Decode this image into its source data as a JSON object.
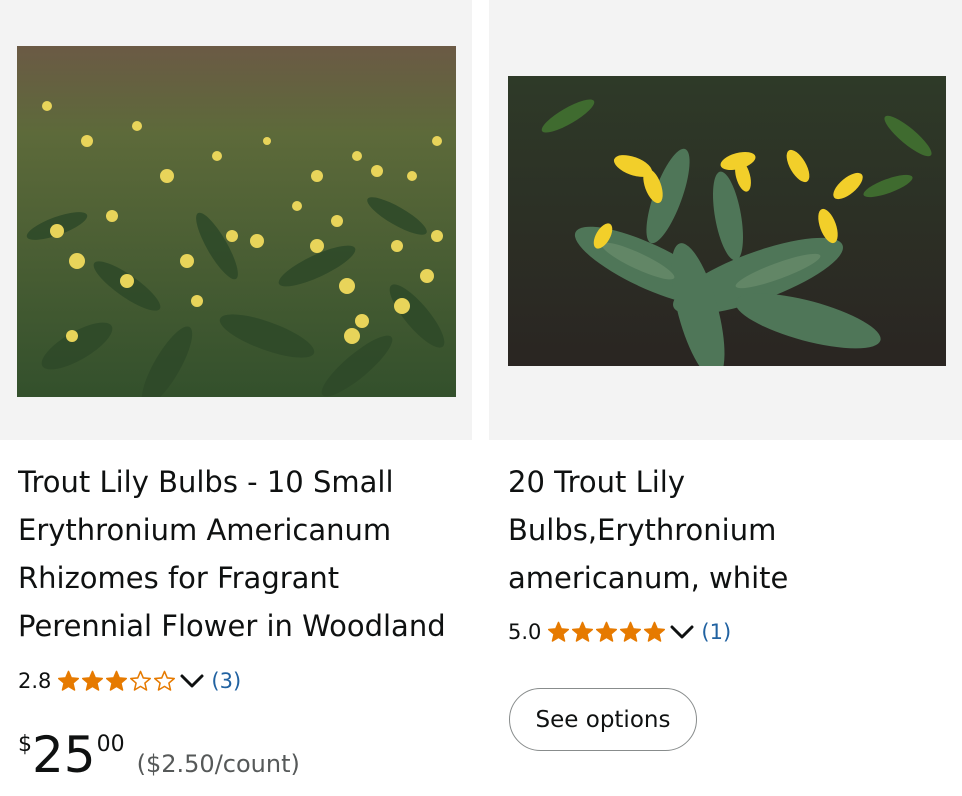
{
  "colors": {
    "star": "#e67a00",
    "link": "#2162a1",
    "image_well": "#f3f3f3"
  },
  "products": [
    {
      "title": "Trout Lily Bulbs - 10 Small Erythronium Americanum Rhizomes for Fragrant Perennial Flower in Woodland",
      "rating": "2.8",
      "stars": [
        1,
        1,
        1,
        0,
        0
      ],
      "review_count": "(3)",
      "price": {
        "symbol": "$",
        "whole": "25",
        "fraction": "00",
        "unit": "($2.50/count)"
      },
      "image_icon": "trout-lily-field-photo"
    },
    {
      "title": "20 Trout Lily Bulbs,Erythronium americanum, white",
      "rating": "5.0",
      "stars": [
        1,
        1,
        1,
        1,
        1
      ],
      "review_count": "(1)",
      "button_label": "See options",
      "image_icon": "trout-lily-closeup-photo"
    }
  ]
}
